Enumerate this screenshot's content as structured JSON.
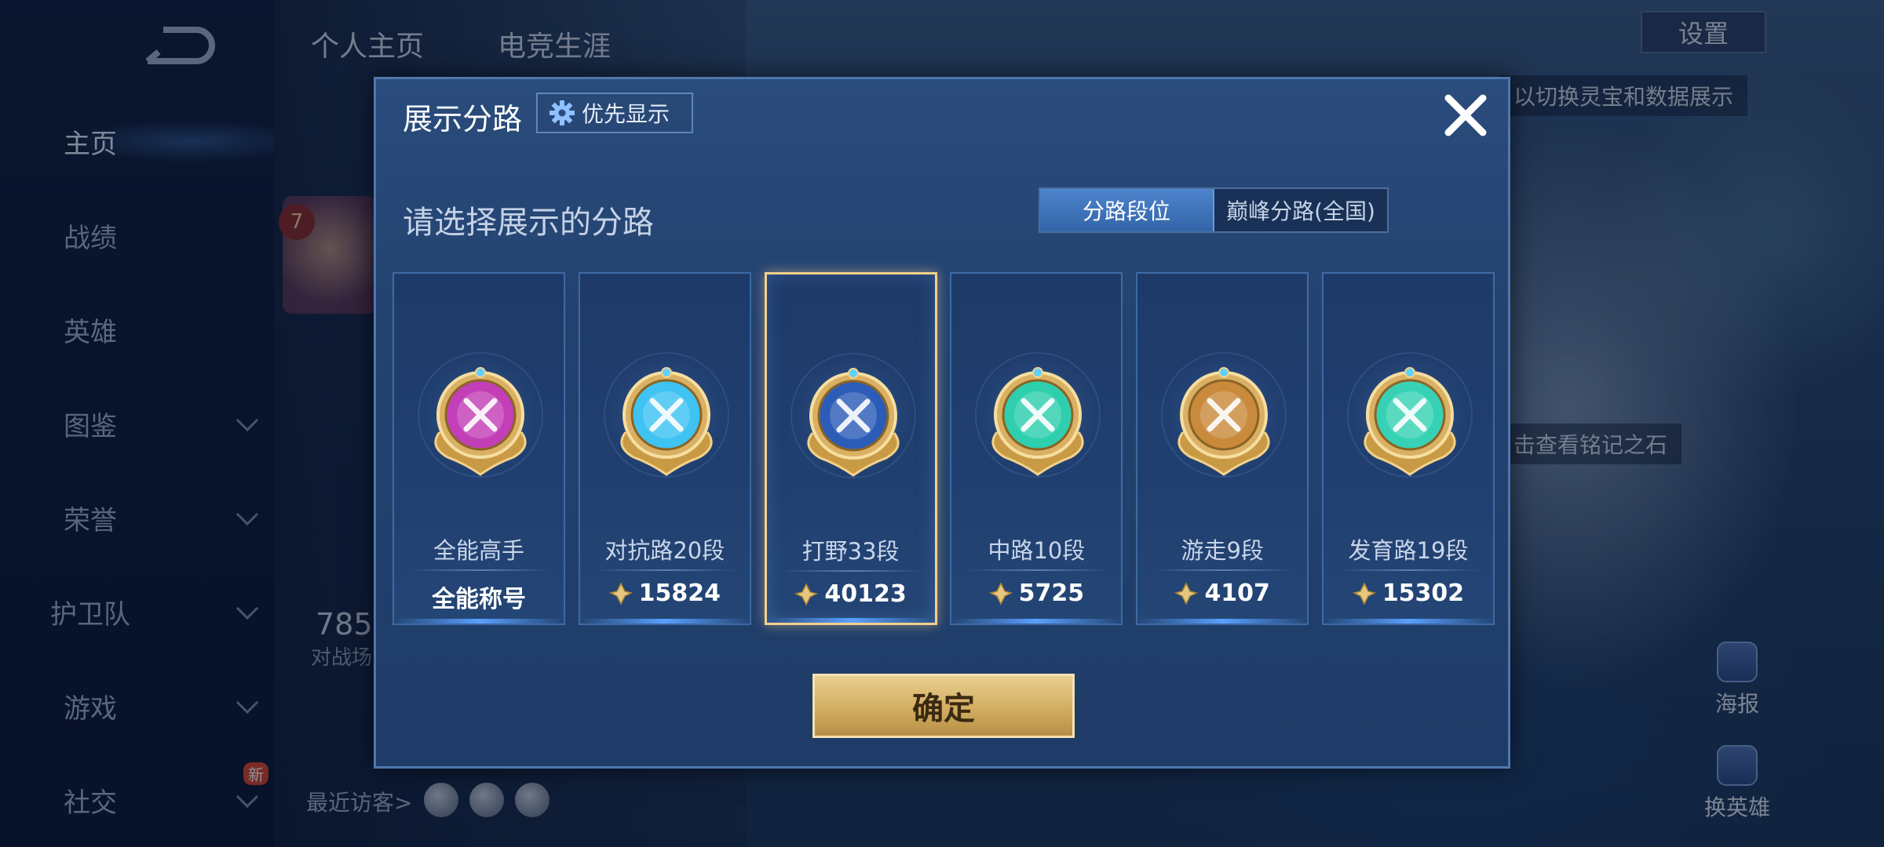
{
  "background": {
    "nav": {
      "items": [
        {
          "label": "主页",
          "active": true,
          "has_chevron": false
        },
        {
          "label": "战绩",
          "active": false,
          "has_chevron": false
        },
        {
          "label": "英雄",
          "active": false,
          "has_chevron": false
        },
        {
          "label": "图鉴",
          "active": false,
          "has_chevron": true
        },
        {
          "label": "荣誉",
          "active": false,
          "has_chevron": true
        },
        {
          "label": "护卫队",
          "active": false,
          "has_chevron": true
        },
        {
          "label": "游戏",
          "active": false,
          "has_chevron": true
        },
        {
          "label": "社交",
          "active": false,
          "has_chevron": true
        }
      ],
      "new_badge": "新"
    },
    "top_tabs": [
      "个人主页",
      "电竞生涯"
    ],
    "settings_label": "设置",
    "hint_top": "以切换灵宝和数据展示",
    "hint_mid": "击查看铭记之石",
    "level": "7",
    "stats_number": "785",
    "stats_label": "对战场",
    "recent_visitors_label": "最近访客>",
    "side_actions": [
      {
        "label": "海报"
      },
      {
        "label": "换英雄"
      }
    ]
  },
  "modal": {
    "title": "展示分路",
    "priority_button": "优先显示",
    "prompt": "请选择展示的分路",
    "segmented": {
      "options": [
        "分路段位",
        "巅峰分路(全国)"
      ],
      "active_index": 0
    },
    "cards": [
      {
        "name": "全能高手",
        "value": "全能称号",
        "has_score_icon": false,
        "emblem": "all-round-emblem-icon",
        "color": "#c23fb7",
        "selected": false
      },
      {
        "name": "对抗路20段",
        "value": "15824",
        "has_score_icon": true,
        "emblem": "clash-lane-emblem-icon",
        "color": "#3ec3f2",
        "selected": false
      },
      {
        "name": "打野33段",
        "value": "40123",
        "has_score_icon": true,
        "emblem": "jungle-emblem-icon",
        "color": "#2b5cb8",
        "selected": true
      },
      {
        "name": "中路10段",
        "value": "5725",
        "has_score_icon": true,
        "emblem": "mid-lane-emblem-icon",
        "color": "#2ecfae",
        "selected": false
      },
      {
        "name": "游走9段",
        "value": "4107",
        "has_score_icon": true,
        "emblem": "roam-emblem-icon",
        "color": "#c98a3c",
        "selected": false
      },
      {
        "name": "发育路19段",
        "value": "15302",
        "has_score_icon": true,
        "emblem": "farm-lane-emblem-icon",
        "color": "#37d2b5",
        "selected": false
      }
    ],
    "confirm_label": "确定"
  }
}
